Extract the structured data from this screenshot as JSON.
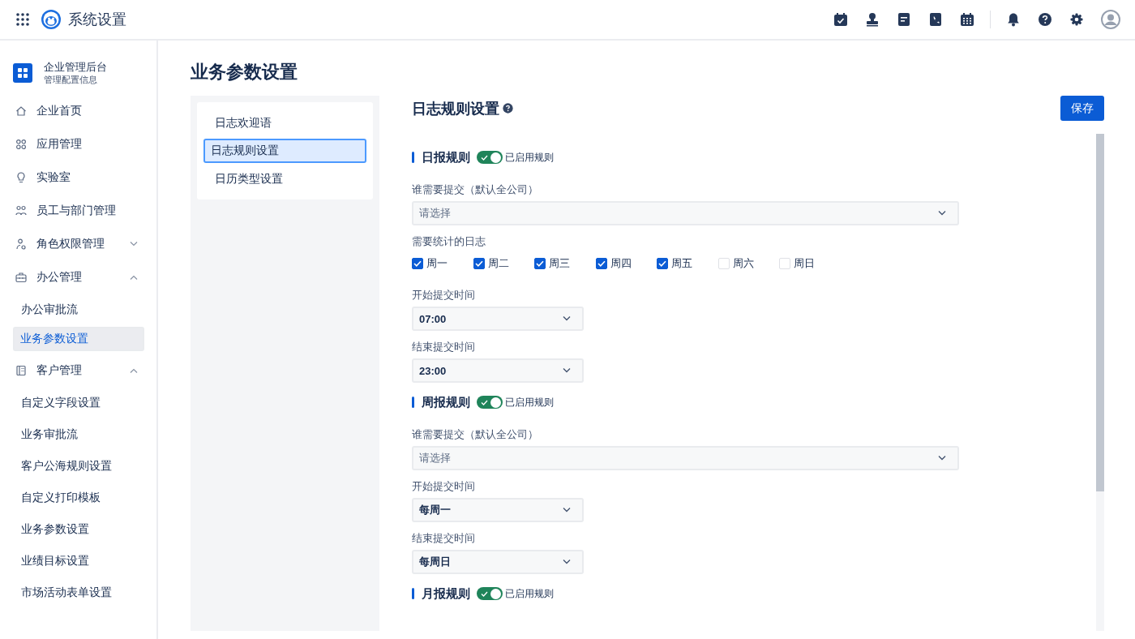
{
  "app": {
    "title": "系统设置"
  },
  "sidebar": {
    "org_name": "企业管理后台",
    "org_sub": "管理配置信息",
    "items": [
      {
        "label": "企业首页",
        "selected": false
      },
      {
        "label": "应用管理",
        "selected": false
      },
      {
        "label": "实验室",
        "selected": false
      },
      {
        "label": "员工与部门管理",
        "selected": false
      },
      {
        "label": "角色权限管理",
        "selected": false,
        "expanded": false
      },
      {
        "label": "办公管理",
        "selected": false,
        "expanded": true,
        "children": [
          {
            "label": "办公审批流",
            "selected": false
          },
          {
            "label": "业务参数设置",
            "selected": true
          }
        ]
      },
      {
        "label": "客户管理",
        "selected": false,
        "expanded": true,
        "children": [
          {
            "label": "自定义字段设置",
            "selected": false
          },
          {
            "label": "业务审批流",
            "selected": false
          },
          {
            "label": "客户公海规则设置",
            "selected": false
          },
          {
            "label": "自定义打印模板",
            "selected": false
          },
          {
            "label": "业务参数设置",
            "selected": false
          },
          {
            "label": "业绩目标设置",
            "selected": false
          },
          {
            "label": "市场活动表单设置",
            "selected": false
          }
        ]
      }
    ]
  },
  "page_title": "业务参数设置",
  "subnav": [
    {
      "label": "日志欢迎语",
      "selected": false
    },
    {
      "label": "日志规则设置",
      "selected": true
    },
    {
      "label": "日历类型设置",
      "selected": false
    }
  ],
  "section": {
    "title": "日志规则设置",
    "save": "保存",
    "rules": [
      {
        "title": "日报规则",
        "on": true,
        "status": "已启用规则",
        "fields": [
          {
            "kind": "picker",
            "label": "谁需要提交（默认全公司）",
            "placeholder": "请选择"
          },
          {
            "kind": "days",
            "label": "需要统计的日志",
            "days": [
              {
                "label": "周一",
                "checked": true
              },
              {
                "label": "周二",
                "checked": true
              },
              {
                "label": "周三",
                "checked": true
              },
              {
                "label": "周四",
                "checked": true
              },
              {
                "label": "周五",
                "checked": true
              },
              {
                "label": "周六",
                "checked": false
              },
              {
                "label": "周日",
                "checked": false
              }
            ]
          },
          {
            "kind": "select",
            "label": "开始提交时间",
            "value": "07:00"
          },
          {
            "kind": "select",
            "label": "结束提交时间",
            "value": "23:00"
          }
        ]
      },
      {
        "title": "周报规则",
        "on": true,
        "status": "已启用规则",
        "fields": [
          {
            "kind": "picker",
            "label": "谁需要提交（默认全公司）",
            "placeholder": "请选择"
          },
          {
            "kind": "select",
            "label": "开始提交时间",
            "value": "每周一"
          },
          {
            "kind": "select",
            "label": "结束提交时间",
            "value": "每周日"
          }
        ]
      },
      {
        "title": "月报规则",
        "on": true,
        "status": "已启用规则"
      }
    ]
  }
}
